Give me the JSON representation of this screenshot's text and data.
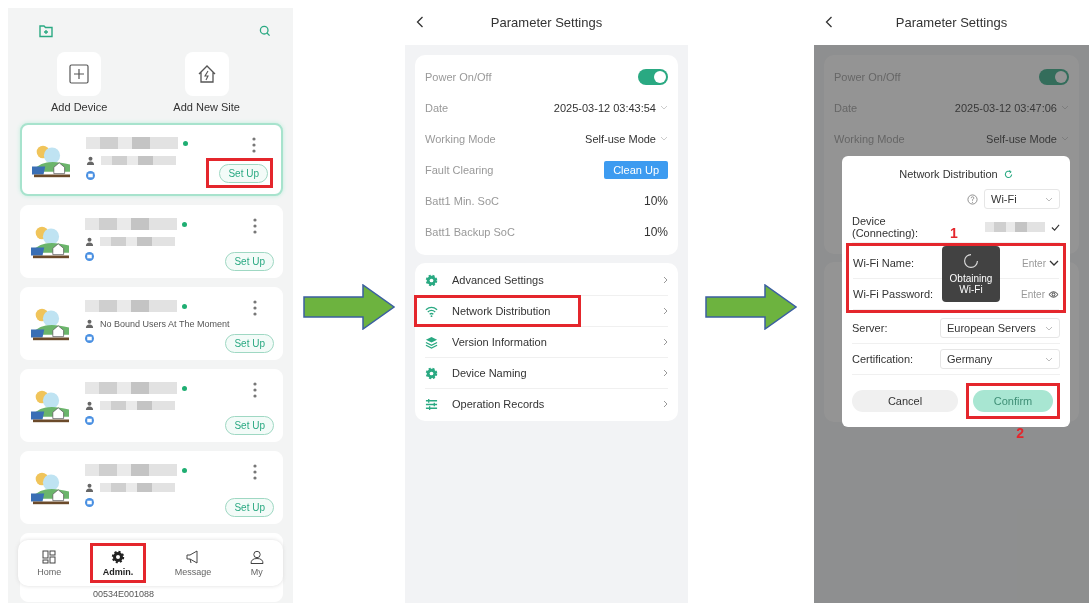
{
  "admin_screen": {
    "quick_actions": [
      {
        "label": "Add Device",
        "kind": "add"
      },
      {
        "label": "Add New Site",
        "kind": "site"
      }
    ],
    "devices": [
      {
        "selected": true,
        "online": true,
        "button": "Set Up",
        "highlighted": true
      },
      {
        "selected": false,
        "online": true,
        "button": "Set Up",
        "highlighted": false
      },
      {
        "selected": false,
        "online": true,
        "user": "No Bound Users At The Moment",
        "button": "Set Up",
        "highlighted": false
      },
      {
        "selected": false,
        "online": true,
        "button": "Set Up",
        "highlighted": false
      },
      {
        "selected": false,
        "online": true,
        "button": "Set Up",
        "highlighted": false
      }
    ],
    "hidden_serial": "00534E001088",
    "nav": [
      {
        "label": "Home",
        "kind": "home",
        "selected": false,
        "highlighted": false
      },
      {
        "label": "Admin.",
        "kind": "admin",
        "selected": true,
        "highlighted": true
      },
      {
        "label": "Message",
        "kind": "message",
        "selected": false,
        "highlighted": false
      },
      {
        "label": "My",
        "kind": "me",
        "selected": false,
        "highlighted": false
      }
    ]
  },
  "settings_screen": {
    "title": "Parameter Settings",
    "params": [
      {
        "kind": "toggle",
        "label": "Power On/Off",
        "on": true
      },
      {
        "kind": "select",
        "label": "Date",
        "value": "2025-03-12 03:43:54"
      },
      {
        "kind": "select",
        "label": "Working Mode",
        "value": "Self-use Mode"
      },
      {
        "kind": "action",
        "label": "Fault Clearing",
        "button": "Clean Up"
      },
      {
        "kind": "value",
        "label": "Batt1 Min. SoC",
        "value": "10%"
      },
      {
        "kind": "value",
        "label": "Batt1 Backup SoC",
        "value": "10%"
      }
    ],
    "menu": [
      {
        "label": "Advanced Settings",
        "kind": "gear",
        "highlighted": false
      },
      {
        "label": "Network Distribution",
        "kind": "wifi",
        "highlighted": true
      },
      {
        "label": "Version Information",
        "kind": "layers",
        "highlighted": false
      },
      {
        "label": "Device Naming",
        "kind": "gear",
        "highlighted": false
      },
      {
        "label": "Operation Records",
        "kind": "records",
        "highlighted": false
      }
    ]
  },
  "network_screen": {
    "title": "Parameter Settings",
    "params": [
      {
        "kind": "toggle",
        "label": "Power On/Off",
        "on": true
      },
      {
        "kind": "select",
        "label": "Date",
        "value": "2025-03-12 03:47:06"
      },
      {
        "kind": "select",
        "label": "Working Mode",
        "value": "Self-use Mode"
      }
    ],
    "dialog": {
      "title": "Network Distribution",
      "mode": "Wi-Fi",
      "fields": [
        {
          "kind": "device",
          "label": "Device (Connecting):",
          "highlighted": false
        },
        {
          "kind": "wifi_name",
          "label": "Wi-Fi Name:",
          "placeholder": "Enter",
          "highlighted": true
        },
        {
          "kind": "password",
          "label": "Wi-Fi Password:",
          "placeholder": "Enter",
          "highlighted": true
        },
        {
          "kind": "select",
          "label": "Server:",
          "value": "European Servers",
          "highlighted": false
        },
        {
          "kind": "select",
          "label": "Certification:",
          "value": "Germany",
          "highlighted": false
        }
      ],
      "cancel": "Cancel",
      "confirm": {
        "label": "Confirm",
        "disabled": true,
        "highlighted": true
      },
      "toast": "Obtaining Wi-Fi",
      "callouts": {
        "fields": "1",
        "confirm": "2"
      }
    }
  }
}
